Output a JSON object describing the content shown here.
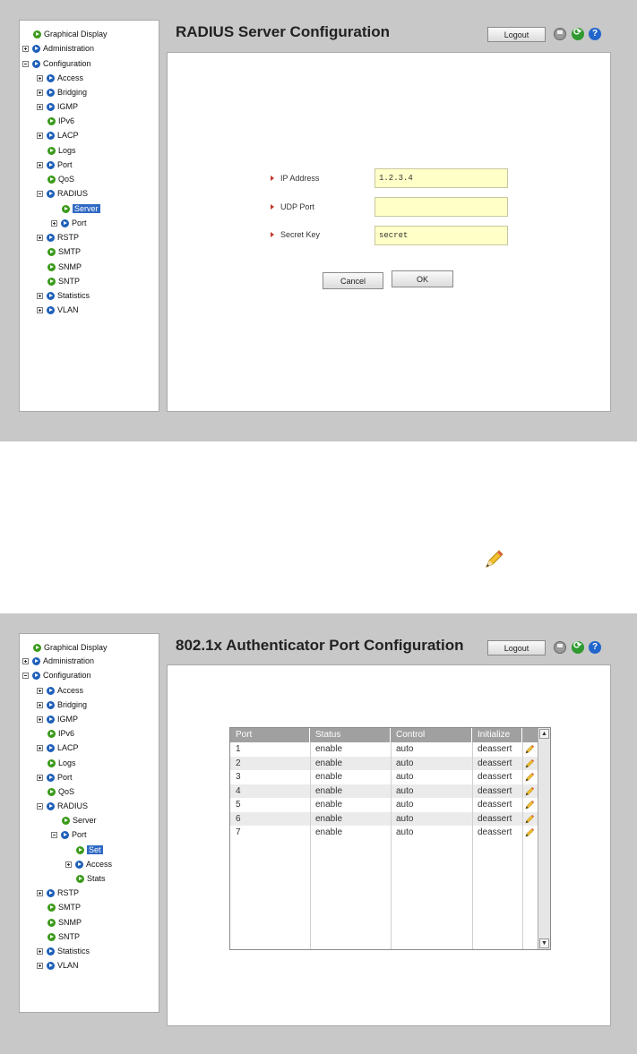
{
  "common": {
    "logout_label": "Logout",
    "icons": [
      "save-icon",
      "refresh-icon",
      "help-icon"
    ],
    "help_glyph": "?"
  },
  "screen1": {
    "title": "RADIUS Server Configuration",
    "tree": [
      {
        "label": "Graphical Display"
      },
      {
        "label": "Administration"
      },
      {
        "label": "Configuration"
      },
      {
        "label": "Access"
      },
      {
        "label": "Bridging"
      },
      {
        "label": "IGMP"
      },
      {
        "label": "IPv6"
      },
      {
        "label": "LACP"
      },
      {
        "label": "Logs"
      },
      {
        "label": "Port"
      },
      {
        "label": "QoS"
      },
      {
        "label": "RADIUS"
      },
      {
        "label": "Server"
      },
      {
        "label": "Port"
      },
      {
        "label": "RSTP"
      },
      {
        "label": "SMTP"
      },
      {
        "label": "SNMP"
      },
      {
        "label": "SNTP"
      },
      {
        "label": "Statistics"
      },
      {
        "label": "VLAN"
      }
    ],
    "form": {
      "ip_label": "IP Address",
      "ip_value": "1.2.3.4",
      "udp_label": "UDP Port",
      "udp_value": "",
      "key_label": "Secret Key",
      "key_value": "secret",
      "cancel_label": "Cancel",
      "ok_label": "OK"
    }
  },
  "screen2": {
    "title": "802.1x Authenticator Port Configuration",
    "tree": [
      {
        "label": "Graphical Display"
      },
      {
        "label": "Administration"
      },
      {
        "label": "Configuration"
      },
      {
        "label": "Access"
      },
      {
        "label": "Bridging"
      },
      {
        "label": "IGMP"
      },
      {
        "label": "IPv6"
      },
      {
        "label": "LACP"
      },
      {
        "label": "Logs"
      },
      {
        "label": "Port"
      },
      {
        "label": "QoS"
      },
      {
        "label": "RADIUS"
      },
      {
        "label": "Server"
      },
      {
        "label": "Port"
      },
      {
        "label": "Set"
      },
      {
        "label": "Access"
      },
      {
        "label": "Stats"
      },
      {
        "label": "RSTP"
      },
      {
        "label": "SMTP"
      },
      {
        "label": "SNMP"
      },
      {
        "label": "SNTP"
      },
      {
        "label": "Statistics"
      },
      {
        "label": "VLAN"
      }
    ],
    "table": {
      "headers": [
        "Port",
        "Status",
        "Control",
        "Initialize"
      ],
      "rows": [
        {
          "port": "1",
          "status": "enable",
          "control": "auto",
          "initialize": "deassert"
        },
        {
          "port": "2",
          "status": "enable",
          "control": "auto",
          "initialize": "deassert"
        },
        {
          "port": "3",
          "status": "enable",
          "control": "auto",
          "initialize": "deassert"
        },
        {
          "port": "4",
          "status": "enable",
          "control": "auto",
          "initialize": "deassert"
        },
        {
          "port": "5",
          "status": "enable",
          "control": "auto",
          "initialize": "deassert"
        },
        {
          "port": "6",
          "status": "enable",
          "control": "auto",
          "initialize": "deassert"
        },
        {
          "port": "7",
          "status": "enable",
          "control": "auto",
          "initialize": "deassert"
        }
      ]
    }
  }
}
